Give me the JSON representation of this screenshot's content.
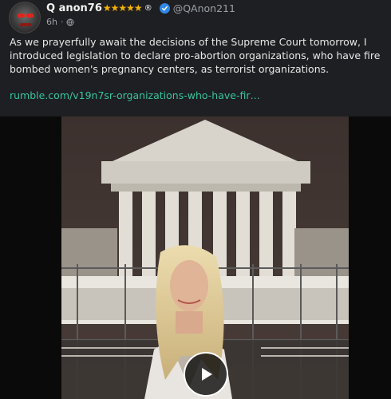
{
  "post": {
    "author": {
      "display_name": "Q anon76",
      "stars": "★★★★★",
      "registered_mark": "®",
      "handle": "@QAnon211",
      "verified": true
    },
    "time_ago": "6h",
    "separator": "·",
    "visibility_icon": "globe-icon",
    "text": "As we prayerfully await the decisions of the Supreme Court tomorrow, I introduced legislation to declare pro-abortion organizations, who have fire bombed women's pregnancy centers, as terrorist organizations.",
    "link_text": "rumble.com/v19n7sr-organizations-who-have-fir…"
  },
  "media": {
    "type": "video",
    "play_icon": "play-icon"
  },
  "colors": {
    "card_bg": "#1e1f22",
    "link": "#35c3a0",
    "verified": "#2f88e8",
    "stars": "#f5b301",
    "muted": "#9aa0a6"
  }
}
